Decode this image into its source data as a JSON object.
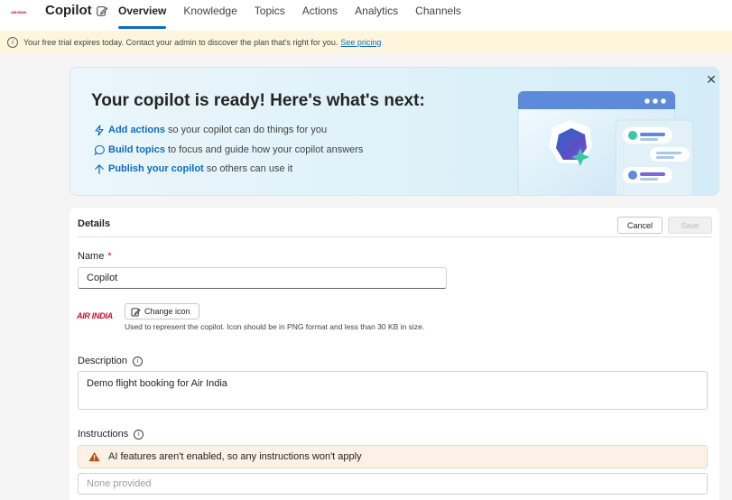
{
  "header": {
    "brand_logo_text": "AIR INDIA",
    "app_title": "Copilot",
    "tabs": [
      {
        "label": "Overview",
        "active": true
      },
      {
        "label": "Knowledge",
        "active": false
      },
      {
        "label": "Topics",
        "active": false
      },
      {
        "label": "Actions",
        "active": false
      },
      {
        "label": "Analytics",
        "active": false
      },
      {
        "label": "Channels",
        "active": false
      }
    ]
  },
  "banner": {
    "text": "Your free trial expires today. Contact your admin to discover the plan that's right for you.",
    "link": "See pricing"
  },
  "hero": {
    "title": "Your copilot is ready! Here's what's next:",
    "items": [
      {
        "link": "Add actions",
        "rest": "so your copilot can do things for you",
        "icon": "lightning-icon"
      },
      {
        "link": "Build topics",
        "rest": "to focus and guide how your copilot answers",
        "icon": "chat-icon"
      },
      {
        "link": "Publish your copilot",
        "rest": "so others can use it",
        "icon": "arrow-up-icon"
      }
    ]
  },
  "details": {
    "title": "Details",
    "cancel_label": "Cancel",
    "save_label": "Save",
    "name_label": "Name",
    "required_mark": "*",
    "name_value": "Copilot",
    "icon_logo_text": "AIR INDIA",
    "change_icon_label": "Change icon",
    "icon_help": "Used to represent the copilot. Icon should be in PNG format and less than 30 KB in size.",
    "description_label": "Description",
    "description_value": "Demo flight booking for Air India",
    "instructions_label": "Instructions",
    "instructions_warning": "AI features aren't enabled, so any instructions won't apply",
    "instructions_placeholder": "None provided"
  },
  "colors": {
    "accent": "#0f6cbd",
    "banner_bg": "#fdf6dd",
    "warning_bg": "#fbf1e6",
    "warning_icon": "#bc4b09",
    "brand_red": "#c8102e"
  }
}
